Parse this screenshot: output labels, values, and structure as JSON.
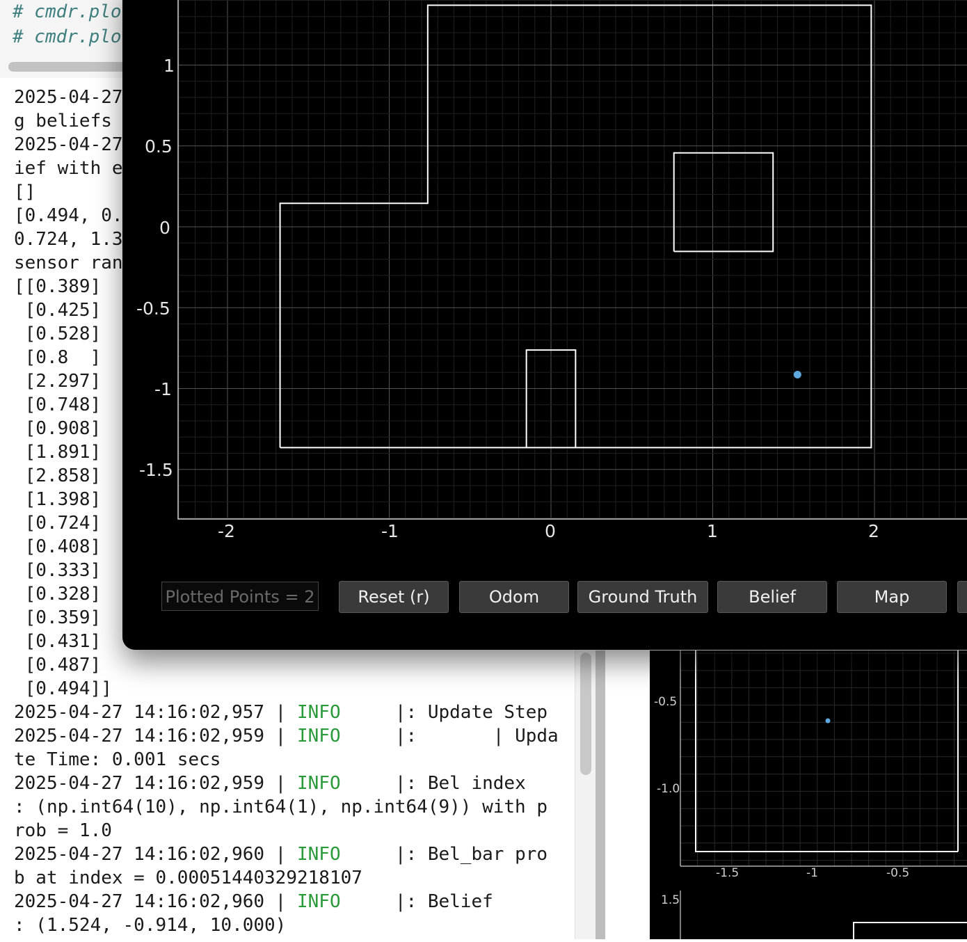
{
  "code_cell": {
    "lines": [
      "# cmdr.plo",
      "# cmdr.plo"
    ]
  },
  "terminal": {
    "lines_truncated": [
      "2025-04-27",
      "g beliefs ",
      "2025-04-27",
      "ief with e",
      "[]",
      "[0.494, 0.",
      "0.724, 1.3",
      "sensor ran",
      "[[0.389]",
      " [0.425]",
      " [0.528]",
      " [0.8  ]",
      " [2.297]",
      " [0.748]",
      " [0.908]",
      " [1.891]",
      " [2.858]",
      " [1.398]",
      " [0.724]",
      " [0.408]",
      " [0.333]",
      " [0.328]",
      " [0.359]",
      " [0.431]",
      " [0.487]",
      " [0.494]]"
    ],
    "log": [
      {
        "pre": "2025-04-27 14:16:02,957 | ",
        "level": "INFO",
        "post": "     |: Update Step"
      },
      {
        "pre": "2025-04-27 14:16:02,959 | ",
        "level": "INFO",
        "post": "     |:       | Upda"
      },
      {
        "plain": "te Time: 0.001 secs"
      },
      {
        "pre": "2025-04-27 14:16:02,959 | ",
        "level": "INFO",
        "post": "     |: Bel index"
      },
      {
        "plain": ": (np.int64(10), np.int64(1), np.int64(9)) with p"
      },
      {
        "plain": "rob = 1.0"
      },
      {
        "pre": "2025-04-27 14:16:02,960 | ",
        "level": "INFO",
        "post": "     |: Bel_bar pro"
      },
      {
        "plain": "b at index = 0.00051440329218107"
      },
      {
        "pre": "2025-04-27 14:16:02,960 | ",
        "level": "INFO",
        "post": "     |: Belief"
      },
      {
        "plain": ": (1.524, -0.914, 10.000)"
      }
    ]
  },
  "plotter": {
    "points_label": "Plotted Points = 2",
    "buttons": {
      "reset": "Reset (r)",
      "odom": "Odom",
      "ground_truth": "Ground Truth",
      "belief": "Belief",
      "map": "Map"
    },
    "x_ticks": [
      "-2",
      "-1",
      "0",
      "1",
      "2"
    ],
    "y_ticks": [
      "1",
      "0.5",
      "0",
      "-0.5",
      "-1",
      "-1.5"
    ],
    "colors": {
      "background": "#000000",
      "map": "#ffffff",
      "belief": "#5ea8e0",
      "grid": "#3a3a3a"
    }
  },
  "map_data": {
    "outer_wall": [
      [
        -1.675,
        -1.365
      ],
      [
        -1.675,
        0.145
      ],
      [
        -0.762,
        0.145
      ],
      [
        -0.762,
        1.37
      ],
      [
        1.98,
        1.37
      ],
      [
        1.98,
        -1.365
      ],
      [
        -1.675,
        -1.365
      ]
    ],
    "box_obstacle": [
      [
        0.76,
        -0.152
      ],
      [
        1.373,
        -0.152
      ],
      [
        1.373,
        0.457
      ],
      [
        0.76,
        0.457
      ],
      [
        0.76,
        -0.152
      ]
    ],
    "small_obstacle": [
      [
        -0.152,
        -1.365
      ],
      [
        -0.152,
        -0.762
      ],
      [
        0.152,
        -0.762
      ],
      [
        0.152,
        -1.365
      ]
    ],
    "belief_point": [
      1.524,
      -0.914
    ]
  },
  "secondary_plot": {
    "y_ticks": [
      "-0.5",
      "-1.0"
    ],
    "x_ticks": [
      "-1.5",
      "-1",
      "-0.5"
    ],
    "y_tick_lower": "1.5"
  }
}
